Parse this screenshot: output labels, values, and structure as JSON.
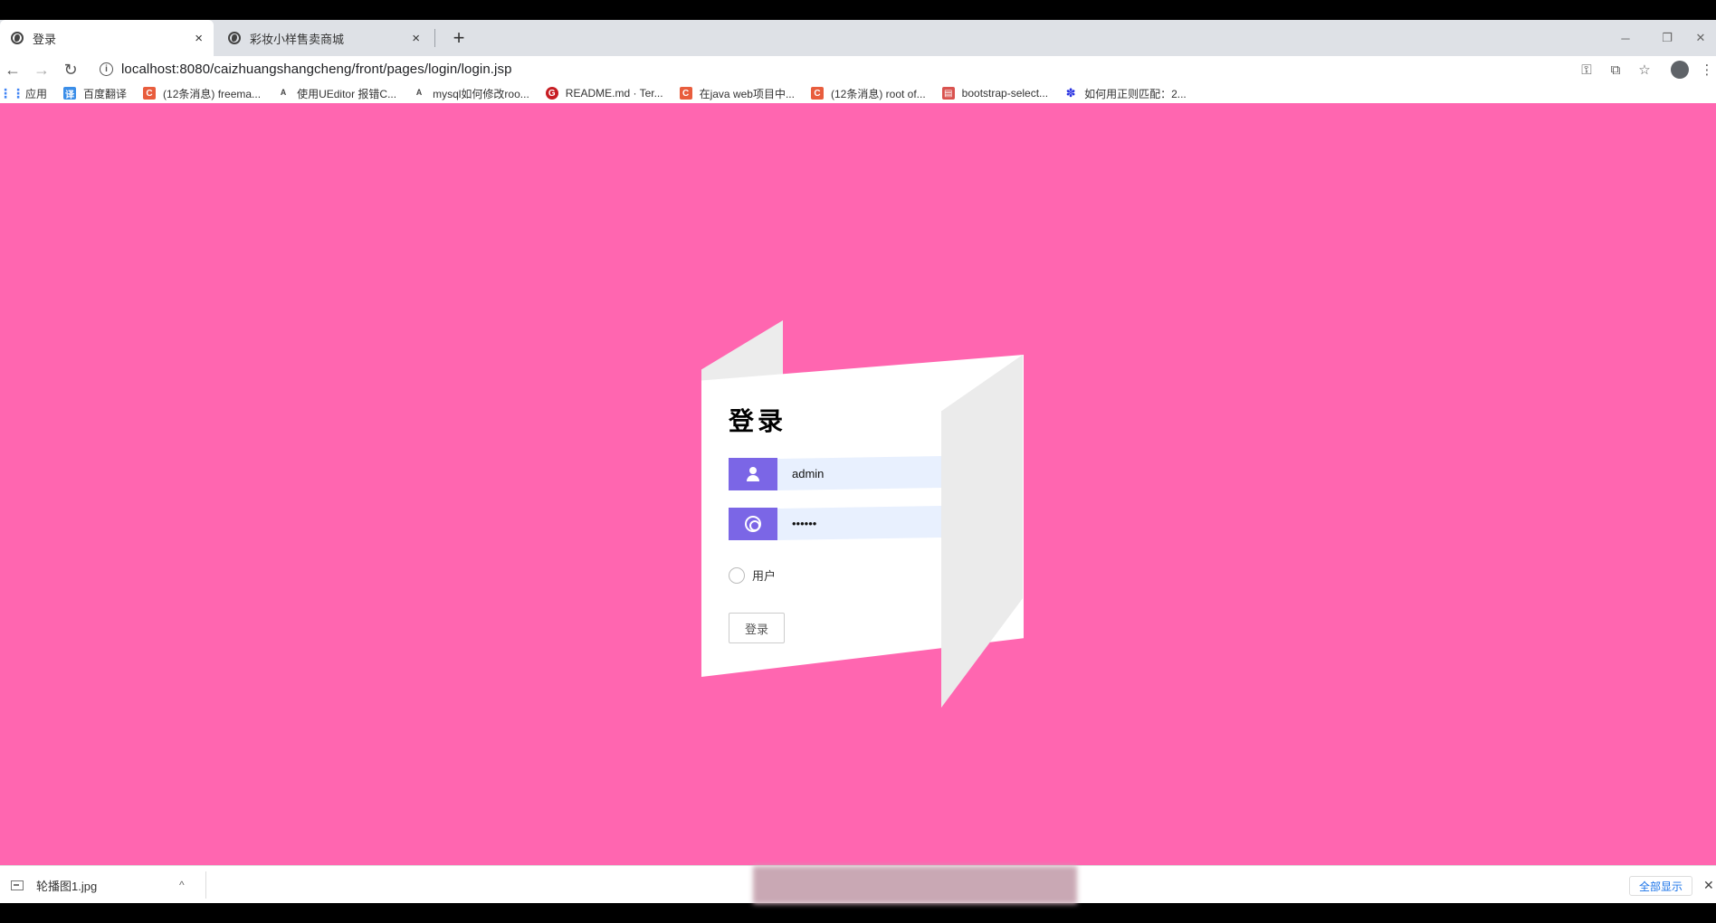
{
  "browser": {
    "tabs": [
      {
        "title": "登录",
        "close": "×"
      },
      {
        "title": "彩妆小样售卖商城",
        "close": "×"
      }
    ],
    "new_tab": "+",
    "window_controls": [
      "─",
      "❐",
      "✕"
    ],
    "nav": {
      "back": "←",
      "forward": "→",
      "reload": "↻"
    },
    "url": "localhost:8080/caizhuangshangcheng/front/pages/login/login.jsp",
    "url_icon": "i",
    "toolbar_icons": [
      "key-icon",
      "translate-icon",
      "star-icon",
      "profile-icon",
      "menu-icon"
    ],
    "bookmarks": [
      {
        "label": "应用",
        "icon": "apps-icon"
      },
      {
        "label": "百度翻译",
        "icon": "baidu-translate-icon"
      },
      {
        "label": "(12条消息) freema...",
        "icon": "csdn-icon"
      },
      {
        "label": "使用UEditor 报错C...",
        "icon": "ueditor-icon"
      },
      {
        "label": "mysql如何修改roo...",
        "icon": "ueditor-icon"
      },
      {
        "label": "README.md · Ter...",
        "icon": "gitee-icon"
      },
      {
        "label": "在java web项目中...",
        "icon": "csdn-icon"
      },
      {
        "label": "(12条消息) root of...",
        "icon": "csdn-icon"
      },
      {
        "label": "bootstrap-select...",
        "icon": "bootstrap-icon"
      },
      {
        "label": "如何用正则匹配：2...",
        "icon": "baidu-paw-icon"
      }
    ]
  },
  "login": {
    "title": "登录",
    "username_value": "admin",
    "password_value": "••••••",
    "role_option": "用户",
    "submit_label": "登录"
  },
  "downloads": {
    "file_name": "轮播图1.jpg",
    "chevron": "^",
    "show_all": "全部显示",
    "close": "✕"
  },
  "colors": {
    "page_background": "#ff66b0",
    "icon_background": "#7b66e6",
    "input_background": "#e8f0fe"
  }
}
